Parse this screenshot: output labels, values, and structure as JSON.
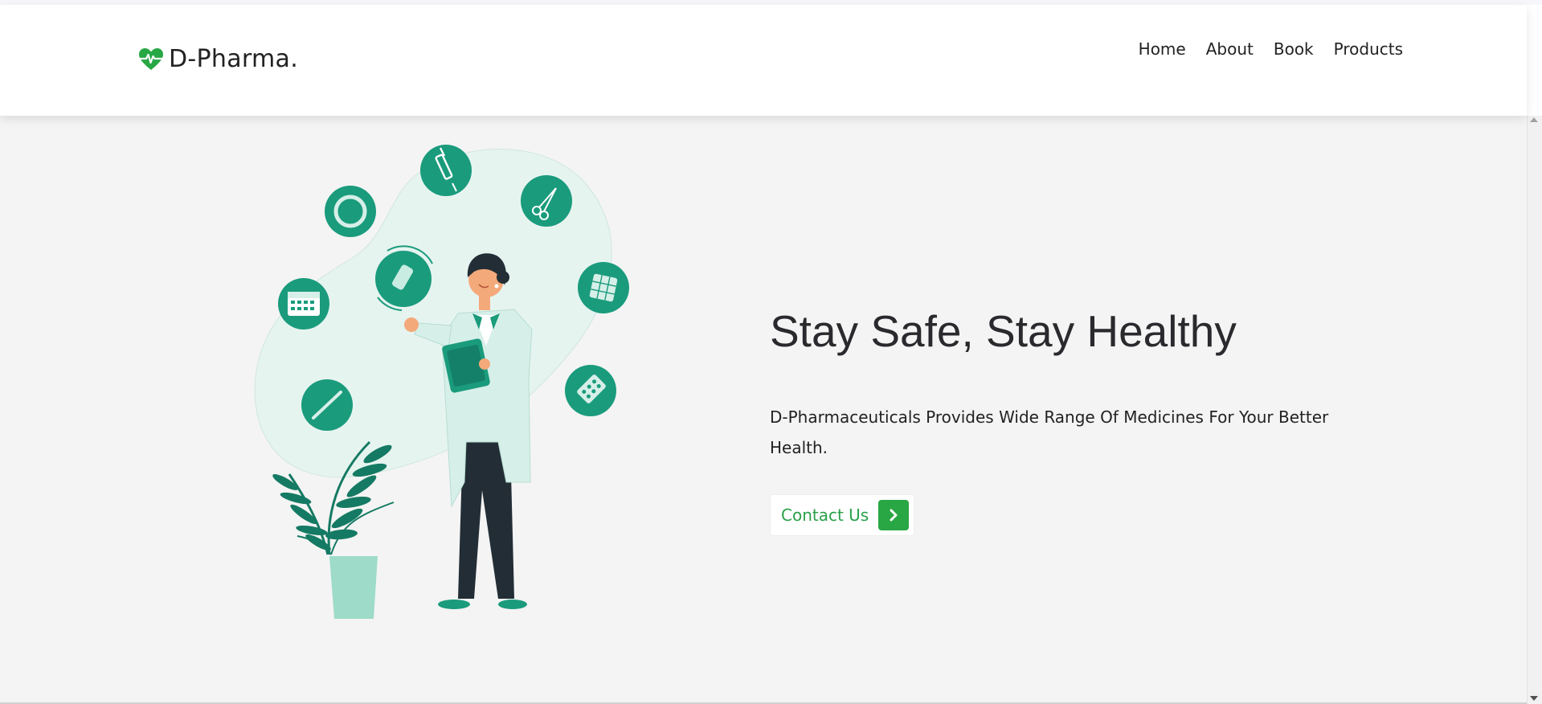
{
  "brand": {
    "name": "D-Pharma.",
    "icon": "heart-pulse-icon",
    "icon_color": "#28a745"
  },
  "nav": {
    "items": [
      {
        "label": "Home"
      },
      {
        "label": "About"
      },
      {
        "label": "Book"
      },
      {
        "label": "Products"
      }
    ]
  },
  "hero": {
    "title": "Stay Safe, Stay Healthy",
    "description": "D-Pharmaceuticals Provides Wide Range Of Medicines For Your Better Health.",
    "cta": {
      "label": "Contact Us",
      "icon": "chevron-right-icon"
    },
    "illustration": "doctor-with-medical-icons-illustration"
  },
  "colors": {
    "accent_green": "#28a745",
    "teal": "#1a9b7c",
    "hero_background": "#f4f4f4"
  }
}
